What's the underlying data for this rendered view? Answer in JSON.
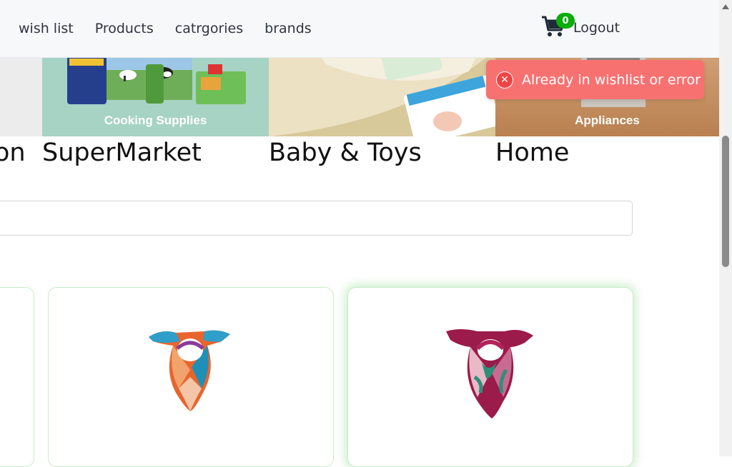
{
  "nav": {
    "links": [
      "wish list",
      "Products",
      "catrgories",
      "brands"
    ],
    "cart_count": "0",
    "logout": "Logout"
  },
  "slider": {
    "slides": [
      {
        "caption": ""
      },
      {
        "caption": "Cooking Supplies"
      },
      {
        "caption": ""
      },
      {
        "caption": "Appliances"
      }
    ]
  },
  "categories": [
    "on",
    "SuperMarket",
    "Baby & Toys",
    "Home"
  ],
  "search": {
    "value": "",
    "placeholder": ""
  },
  "toast": {
    "message": "Already in wishlist or error",
    "icon": "error-x-icon"
  },
  "colors": {
    "brand": "#0aad0a",
    "toast": "#f87171",
    "toast_icon": "#ef4444"
  }
}
